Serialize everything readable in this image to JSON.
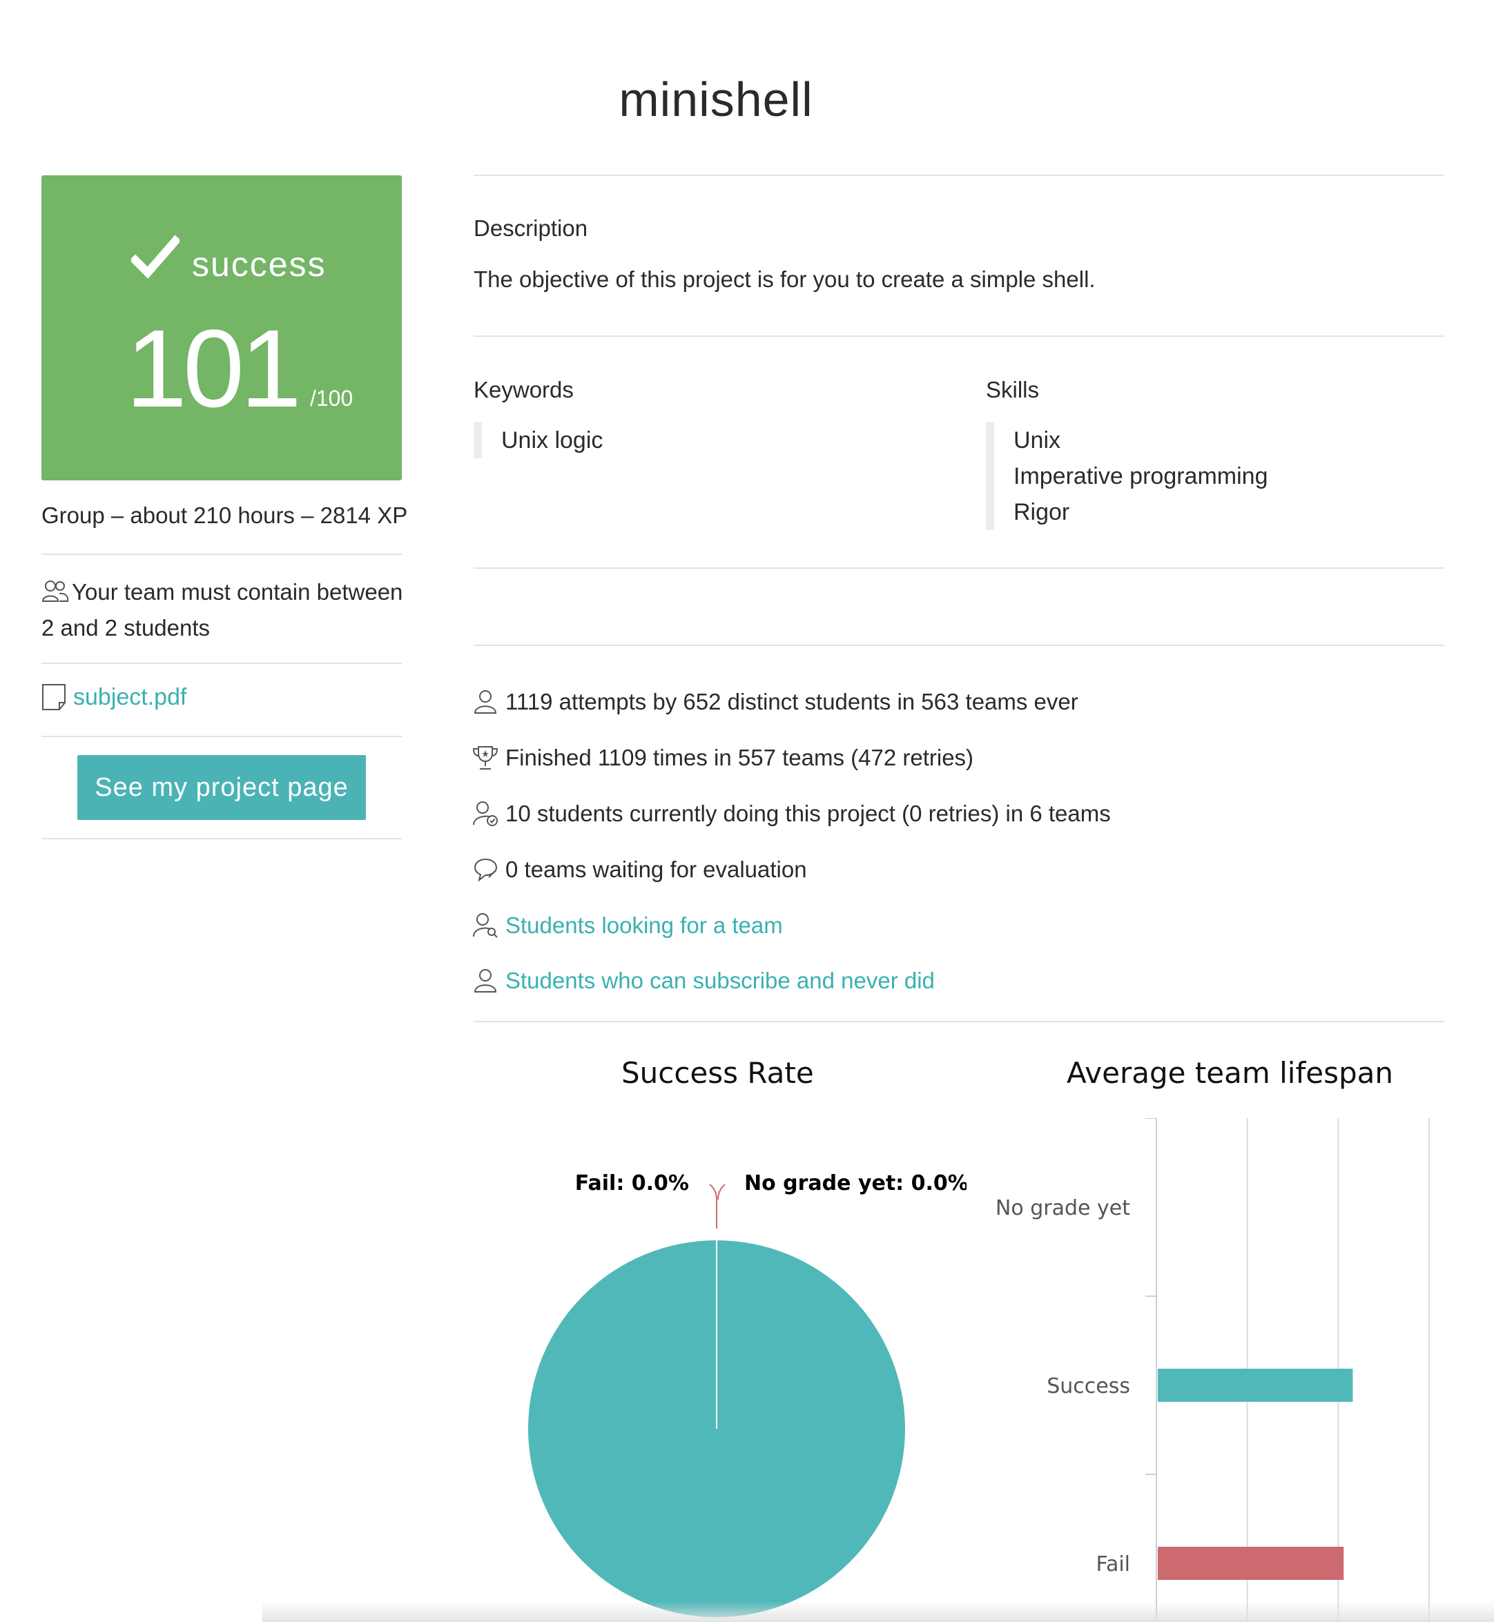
{
  "project": {
    "title": "minishell"
  },
  "status": {
    "label": "success",
    "score": "101",
    "score_max": "/100",
    "color": "#74b566"
  },
  "meta": {
    "line": "Group – about 210 hours – 2814 XP"
  },
  "team_requirement": {
    "text": "Your team must contain between 2 and 2 students",
    "icon": "users-icon"
  },
  "subject": {
    "link_text": "subject.pdf",
    "icon": "document-icon"
  },
  "project_button": {
    "label": "See my project page"
  },
  "description": {
    "heading": "Description",
    "text": "The objective of this project is for you to create a simple shell."
  },
  "keywords": {
    "heading": "Keywords",
    "items": [
      "Unix logic"
    ]
  },
  "skills": {
    "heading": "Skills",
    "items": [
      "Unix",
      "Imperative programming",
      "Rigor"
    ]
  },
  "stats": [
    {
      "icon": "user-icon",
      "text": "1119 attempts by 652 distinct students in 563 teams ever",
      "link": false
    },
    {
      "icon": "trophy-icon",
      "text": "Finished 1109 times in 557 teams (472 retries)",
      "link": false
    },
    {
      "icon": "user-clock-icon",
      "text": "10 students currently doing this project (0 retries) in 6 teams",
      "link": false
    },
    {
      "icon": "speech-bubble-icon",
      "text": "0 teams waiting for evaluation",
      "link": false
    },
    {
      "icon": "user-search-icon",
      "text": "Students looking for a team",
      "link": true
    },
    {
      "icon": "user-icon",
      "text": "Students who can subscribe and never did",
      "link": true
    }
  ],
  "chart_data": [
    {
      "type": "pie",
      "title": "Success Rate",
      "slices": [
        {
          "label": "Success",
          "value": 100.0,
          "color": "#50b8b9"
        },
        {
          "label": "Fail",
          "value": 0.0,
          "color": "#cc6a70"
        },
        {
          "label": "No grade yet",
          "value": 0.0,
          "color": "#cc6a70"
        }
      ],
      "data_labels": [
        "Fail: 0.0%",
        "No grade yet: 0.0%"
      ]
    },
    {
      "type": "bar",
      "orientation": "horizontal",
      "title": "Average team lifespan",
      "categories": [
        "No grade yet",
        "Success",
        "Fail"
      ],
      "values": [
        0,
        1.08,
        1.03
      ],
      "colors": [
        "#50b8b9",
        "#50b8b9",
        "#cc6a70"
      ],
      "xlim": [
        0,
        1.5
      ],
      "grid": true
    }
  ]
}
